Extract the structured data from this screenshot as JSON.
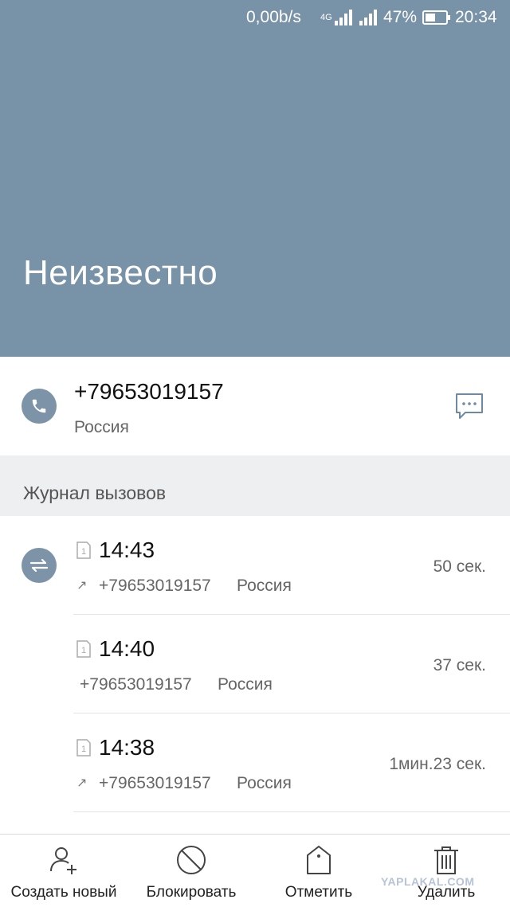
{
  "status_bar": {
    "speed": "0,00b/s",
    "network": "4G",
    "battery": "47%",
    "time": "20:34"
  },
  "contact": {
    "name": "Неизвестно",
    "number": "+79653019157",
    "country": "Россия"
  },
  "call_log": {
    "title": "Журнал вызовов",
    "entries": [
      {
        "time": "14:43",
        "number": "+79653019157",
        "country": "Россия",
        "duration": "50 сек.",
        "outgoing": true
      },
      {
        "time": "14:40",
        "number": "+79653019157",
        "country": "Россия",
        "duration": "37 сек.",
        "outgoing": false
      },
      {
        "time": "14:38",
        "number": "+79653019157",
        "country": "Россия",
        "duration": "1мин.23 сек.",
        "outgoing": true
      }
    ]
  },
  "actions": {
    "create": "Создать новый",
    "block": "Блокировать",
    "mark": "Отметить",
    "delete": "Удалить"
  },
  "watermark": "YAPLAKAL.COM",
  "icons": {
    "phone": "phone-icon",
    "message": "message-icon",
    "swap": "swap-icon",
    "sim": "sim-1-icon",
    "outgoing": "outgoing-arrow-icon",
    "add_contact": "add-contact-icon",
    "block": "block-icon",
    "tag": "tag-icon",
    "trash": "trash-icon"
  },
  "colors": {
    "header_bg": "#7892a8",
    "icon_circle": "#7d93a8",
    "section_bg": "#eeeff1"
  }
}
